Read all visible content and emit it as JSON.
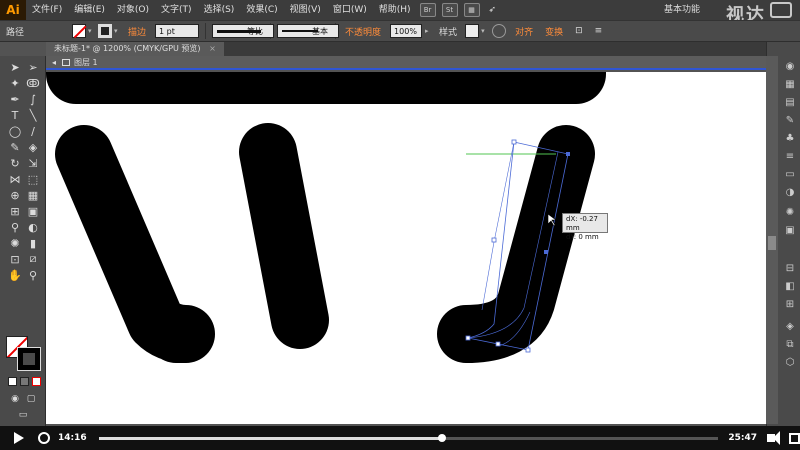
{
  "app": {
    "logo": "Ai"
  },
  "menu": {
    "items": [
      "文件(F)",
      "编辑(E)",
      "对象(O)",
      "文字(T)",
      "选择(S)",
      "效果(C)",
      "视图(V)",
      "窗口(W)",
      "帮助(H)"
    ],
    "icon_br": "Br",
    "icon_st": "St",
    "workspace_label": "基本功能",
    "watermark": "视达"
  },
  "control_bar": {
    "selection_label": "路径",
    "stroke_label": "描边",
    "stroke_weight": "1 pt",
    "profile_label": "等比",
    "brush_label": "基本",
    "opacity_label": "不透明度",
    "opacity_value": "100%",
    "style_label": "样式",
    "align_label": "对齐",
    "transform_label": "变换"
  },
  "document": {
    "tab_title": "未标题-1* @ 1200% (CMYK/GPU 预览)",
    "tab_close": "×",
    "layer_name": "图层 1"
  },
  "tooltip": {
    "dx": "dX: -0.27 mm",
    "dy": "dY: 0 mm"
  },
  "player": {
    "current_time": "14:16",
    "total_time": "25:47",
    "progress": 0.553
  },
  "colors": {
    "selection_path": "#4b6ad6",
    "guide": "#52c452",
    "accent_orange": "#ff8c3a",
    "canvas": "#ffffff",
    "shape": "#000000"
  },
  "icons": {
    "toolbar": [
      "selection-arrow-icon",
      "direct-selection-icon",
      "magic-wand-icon",
      "lasso-icon",
      "pen-icon",
      "curvature-icon",
      "type-icon",
      "line-icon",
      "ellipse-icon",
      "paintbrush-icon",
      "pencil-icon",
      "eraser-icon",
      "rotate-icon",
      "scale-icon",
      "width-icon",
      "free-transform-icon",
      "shape-builder-icon",
      "perspective-icon",
      "mesh-icon",
      "gradient-icon",
      "eyedropper-icon",
      "blend-icon",
      "symbol-sprayer-icon",
      "graph-icon",
      "artboard-icon",
      "slice-icon",
      "hand-icon",
      "zoom-icon"
    ]
  }
}
